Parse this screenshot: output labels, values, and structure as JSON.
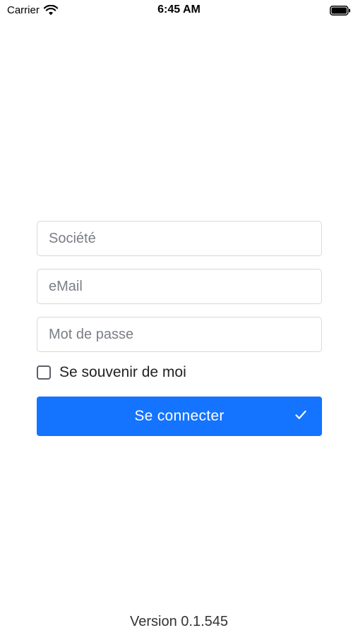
{
  "status_bar": {
    "carrier": "Carrier",
    "time": "6:45 AM",
    "wifi_icon": "wifi-icon",
    "battery_icon": "battery-icon"
  },
  "form": {
    "company_placeholder": "Société",
    "email_placeholder": "eMail",
    "password_placeholder": "Mot de passe",
    "remember_label": "Se souvenir de moi",
    "remember_checked": false,
    "login_label": "Se connecter",
    "login_icon": "check-icon"
  },
  "footer": {
    "version": "Version 0.1.545"
  },
  "colors": {
    "primary": "#1474ff",
    "border": "#d5d8dc",
    "placeholder": "#7a7f86"
  }
}
